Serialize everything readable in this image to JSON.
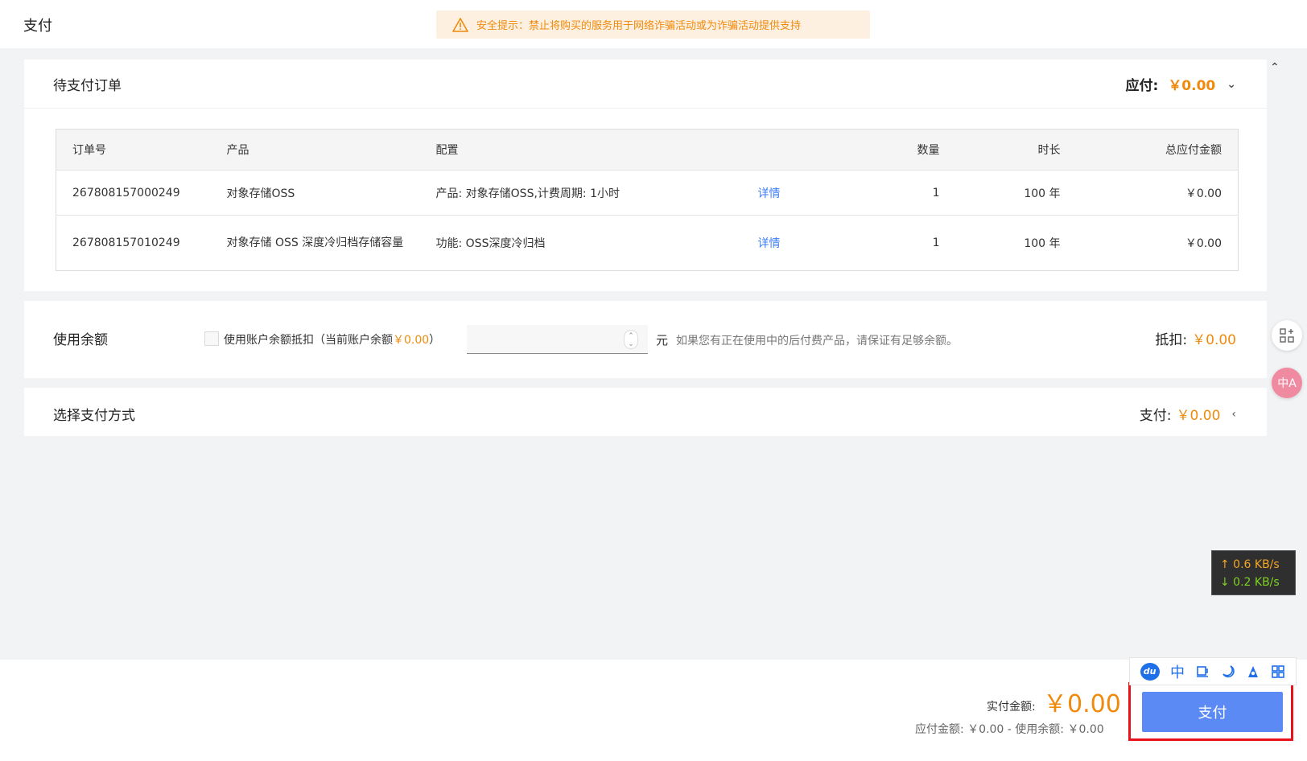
{
  "header": {
    "title": "支付",
    "security_notice": "安全提示：禁止将购买的服务用于网络诈骗活动或为诈骗活动提供支持"
  },
  "orders": {
    "title": "待支付订单",
    "payable_label": "应付:",
    "payable_value": "￥0.00",
    "columns": {
      "order_no": "订单号",
      "product": "产品",
      "config": "配置",
      "quantity": "数量",
      "duration": "时长",
      "total": "总应付金额"
    },
    "rows": [
      {
        "order_no": "267808157000249",
        "product": "对象存储OSS",
        "config": "产品: 对象存储OSS,计费周期: 1小时",
        "detail": "详情",
        "quantity": "1",
        "duration": "100 年",
        "total": "￥0.00"
      },
      {
        "order_no": "267808157010249",
        "product": "对象存储 OSS 深度冷归档存储容量",
        "config": "功能: OSS深度冷归档",
        "detail": "详情",
        "quantity": "1",
        "duration": "100 年",
        "total": "￥0.00"
      }
    ]
  },
  "balance": {
    "title": "使用余额",
    "checkbox_label_prefix": "使用账户余额抵扣（当前账户余额",
    "checkbox_label_amount": "￥0.00",
    "checkbox_label_suffix": "）",
    "input_value": "",
    "unit": "元",
    "hint": "如果您有正在使用中的后付费产品，请保证有足够余额。",
    "deduct_label": "抵扣:",
    "deduct_value": "￥0.00"
  },
  "payment_method": {
    "title": "选择支付方式",
    "pay_label": "支付:",
    "pay_value": "￥0.00"
  },
  "footer": {
    "actual_label": "实付金额:",
    "actual_amount": "￥0.00",
    "detail": "应付金额: ￥0.00 - 使用余额: ￥0.00",
    "pay_button": "支付"
  },
  "netspeed": {
    "up": "↑ 0.6 KB/s",
    "down": "↓ 0.2 KB/s"
  },
  "ime_toolbar": {
    "logo": "du",
    "lang": "中"
  },
  "float": {
    "translate": "中A"
  },
  "colors": {
    "accent_orange": "#f08a0d",
    "primary_blue": "#5b8af5",
    "link_blue": "#3a7cf5",
    "highlight_red": "#e8121b"
  }
}
